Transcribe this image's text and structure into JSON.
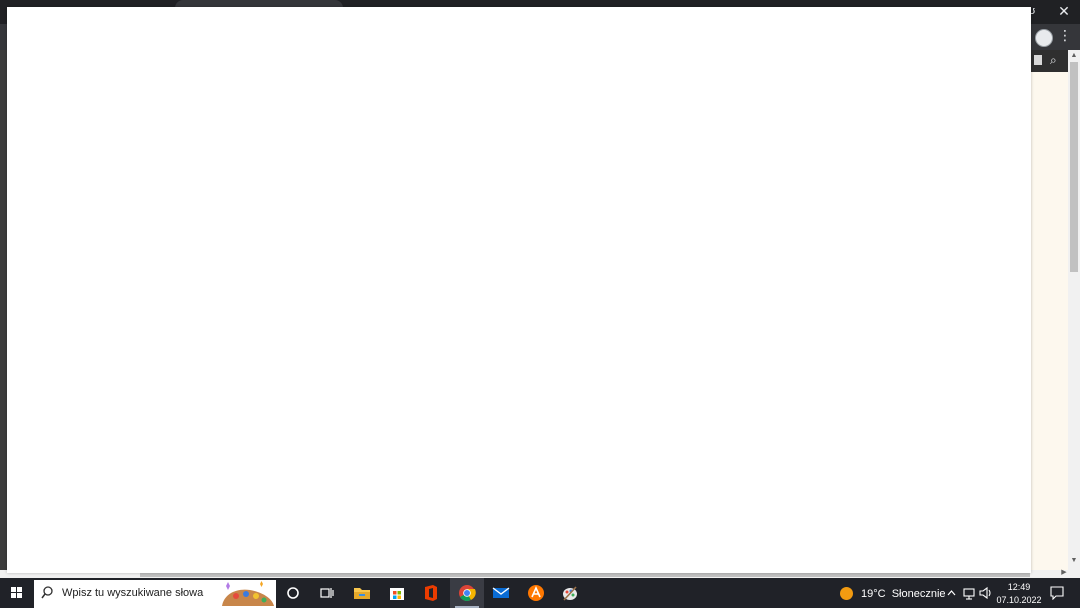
{
  "window": {
    "restore_glyph": "ʊ",
    "close_glyph": "✕",
    "menu_glyph": "⋮"
  },
  "sidepanel": {
    "search_glyph": "⌕"
  },
  "scrollbar": {
    "up_glyph": "▲",
    "down_glyph": "▼",
    "right_glyph": "▶"
  },
  "taskbar": {
    "search_placeholder": "Wpisz tu wyszukiwane słowa",
    "apps": [
      {
        "name": "cortana",
        "icon": "circle-icon"
      },
      {
        "name": "task-view",
        "icon": "task-view-icon"
      },
      {
        "name": "file-explorer",
        "icon": "folder-icon"
      },
      {
        "name": "microsoft-store",
        "icon": "store-icon"
      },
      {
        "name": "office",
        "icon": "office-icon"
      },
      {
        "name": "chrome",
        "icon": "chrome-icon",
        "active": true
      },
      {
        "name": "mail",
        "icon": "mail-icon"
      },
      {
        "name": "avast",
        "icon": "avast-icon"
      },
      {
        "name": "paint",
        "icon": "paint-icon"
      }
    ],
    "weather": {
      "temp": "19°C",
      "condition": "Słonecznie"
    },
    "clock": {
      "time": "12:49",
      "date": "07.10.2022"
    }
  },
  "colors": {
    "chrome_dark": "#202124",
    "toolbar": "#35363a",
    "taskbar": "#202228",
    "overlay": "#ffffff",
    "weather_sun": "#f29b11",
    "chrome_red": "#db4437",
    "chrome_green": "#0f9d58",
    "chrome_yellow": "#f4b400",
    "chrome_blue": "#4285f4"
  }
}
